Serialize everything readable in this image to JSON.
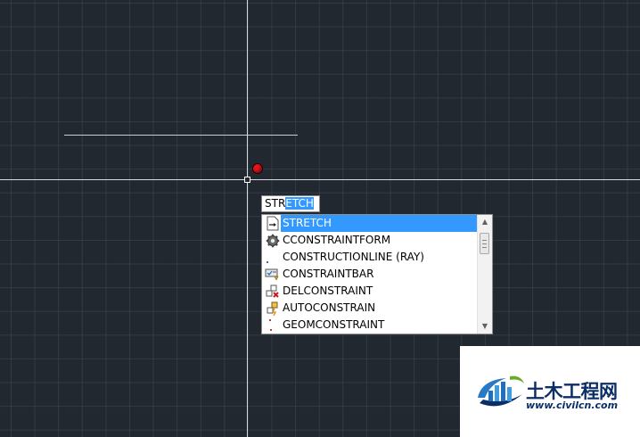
{
  "command_input": {
    "typed": "STR",
    "completion": "ETCH"
  },
  "autocomplete": {
    "items": [
      {
        "label": "STRETCH",
        "icon": "stretch-icon",
        "selected": true
      },
      {
        "label": "CCONSTRAINTFORM",
        "icon": "gear-icon"
      },
      {
        "label": "CONSTRUCTIONLINE (RAY)",
        "icon": "dot-icon"
      },
      {
        "label": "CONSTRAINTBAR",
        "icon": "constraint-bar-icon"
      },
      {
        "label": "DELCONSTRAINT",
        "icon": "delete-constraint-icon"
      },
      {
        "label": "AUTOCONSTRAIN",
        "icon": "auto-constrain-icon"
      },
      {
        "label": "GEOMCONSTRAINT",
        "icon": "geom-constraint-icon"
      }
    ],
    "scroll_up_icon": "triangle-up-icon",
    "scroll_down_icon": "triangle-down-icon"
  },
  "colors": {
    "canvas_background": "#212830",
    "grid_line": "#46505e",
    "crosshair": "#d7dade",
    "snap_marker": "#e3141c",
    "selection": "#3399ff",
    "watermark_text": "#0c2e66"
  },
  "watermark": {
    "name": "土木工程网",
    "url": "www.civilcn.com"
  }
}
